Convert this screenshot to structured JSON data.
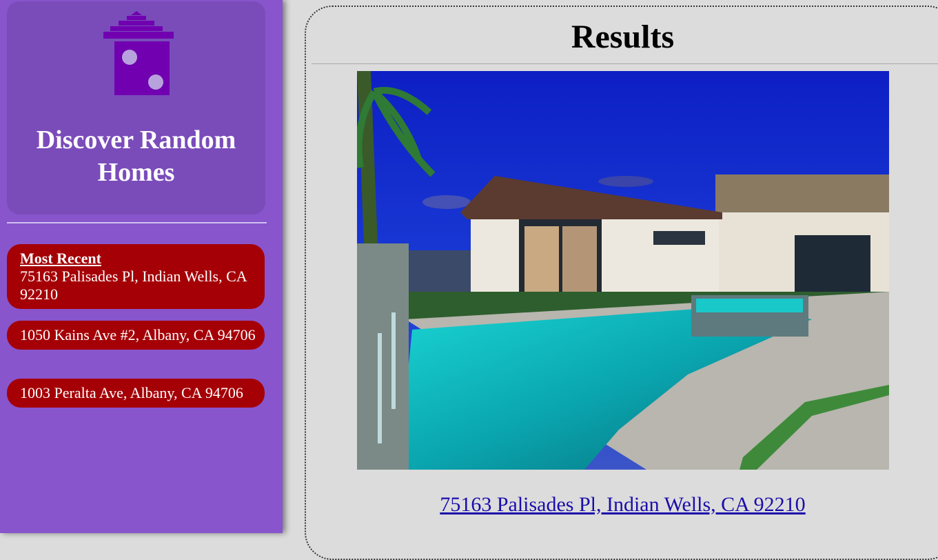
{
  "sidebar": {
    "logo_icon": "house-dice-icon",
    "brand_title": "Discover Random Homes",
    "recent_heading": "Most Recent",
    "items": [
      {
        "address": "75163 Palisades Pl, Indian Wells, CA 92210"
      },
      {
        "address": "1050 Kains Ave #2, Albany, CA 94706"
      },
      {
        "address": "1003 Peralta Ave, Albany, CA 94706"
      }
    ]
  },
  "main": {
    "title": "Results",
    "photo_icon": "house-pool-photo",
    "address_link": "75163 Palisades Pl, Indian Wells, CA 92210"
  },
  "colors": {
    "sidebar_bg": "#8855cc",
    "brand_panel": "#7a4cba",
    "logo": "#7000b0",
    "card_bg": "#a50006",
    "link": "#1a0dab"
  }
}
